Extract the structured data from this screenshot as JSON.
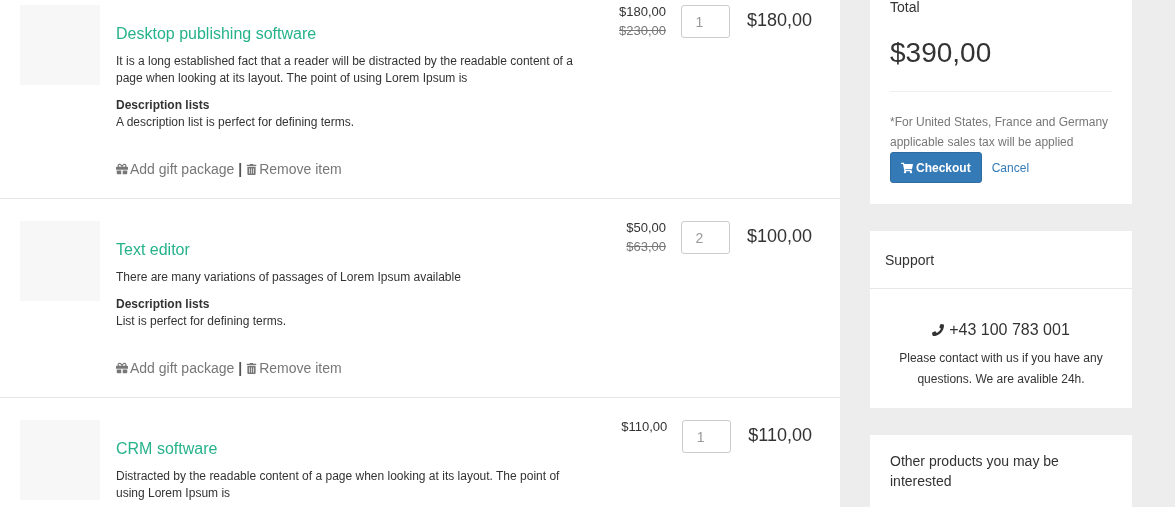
{
  "cart_items": [
    {
      "title": "Desktop publishing software",
      "description": "It is a long established fact that a reader will be distracted by the readable content of a page when looking at its layout. The point of using Lorem Ipsum is",
      "list_heading": "Description lists",
      "list_text": "A description list is perfect for defining terms.",
      "price": "$180,00",
      "old_price": "$230,00",
      "quantity": "1",
      "total": "$180,00",
      "gift_action": "Add gift package",
      "separator": "|",
      "remove_action": "Remove item"
    },
    {
      "title": "Text editor",
      "description": "There are many variations of passages of Lorem Ipsum available",
      "list_heading": "Description lists",
      "list_text": "List is perfect for defining terms.",
      "price": "$50,00",
      "old_price": "$63,00",
      "quantity": "2",
      "total": "$100,00",
      "gift_action": "Add gift package",
      "separator": "|",
      "remove_action": "Remove item"
    },
    {
      "title": "CRM software",
      "description": "Distracted by the readable content of a page when looking at its layout. The point of using Lorem Ipsum is",
      "price": "$110,00",
      "quantity": "1",
      "total": "$110,00"
    }
  ],
  "summary": {
    "label": "Total",
    "amount": "$390,00",
    "note": "*For United States, France and Germany applicable sales tax will be applied",
    "checkout_button": "Checkout",
    "cancel_link": "Cancel"
  },
  "support": {
    "title": "Support",
    "phone": "+43 100 783 001",
    "text": "Please contact with us if you have any questions. We are avalible 24h."
  },
  "other_products": {
    "title": "Other products you may be interested"
  }
}
